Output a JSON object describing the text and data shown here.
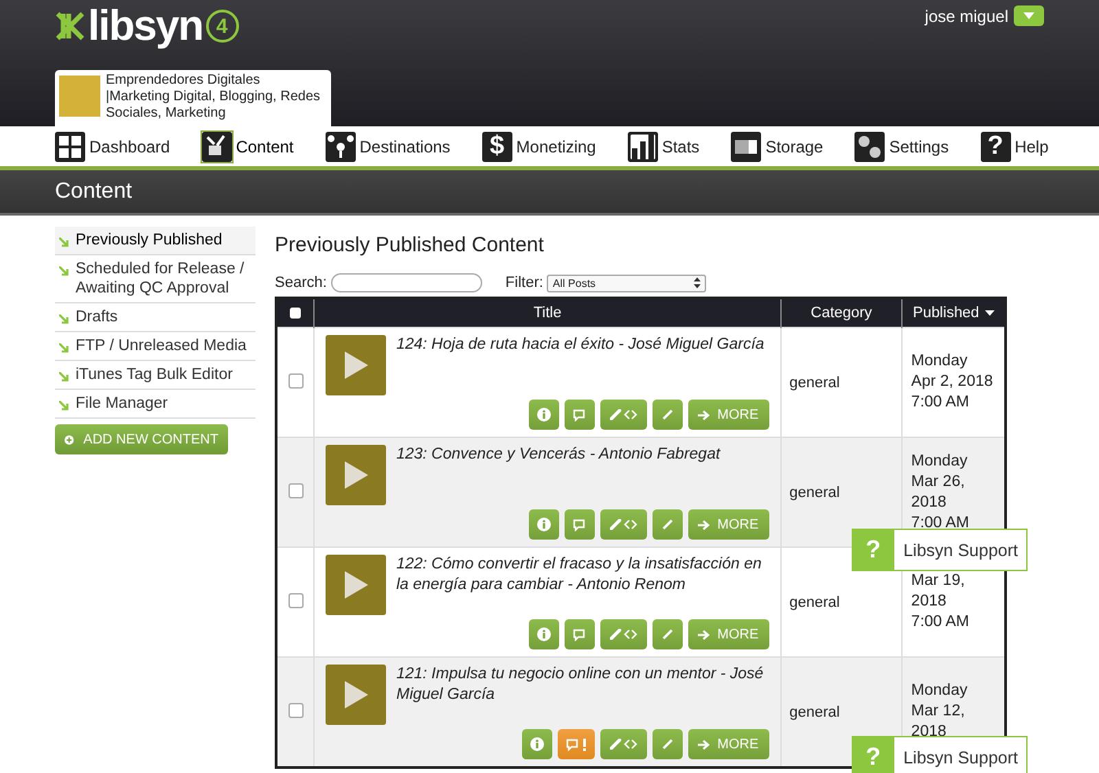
{
  "header": {
    "logo": "libsyn",
    "logo_badge": "4",
    "user": "jose miguel"
  },
  "podcast": {
    "title": "Emprendedores Digitales |Marketing Digital, Blogging, Redes Sociales, Marketing"
  },
  "nav": [
    {
      "label": "Dashboard",
      "selected": false
    },
    {
      "label": "Content",
      "selected": true
    },
    {
      "label": "Destinations",
      "selected": false
    },
    {
      "label": "Monetizing",
      "glyph": "$",
      "selected": false
    },
    {
      "label": "Stats",
      "selected": false
    },
    {
      "label": "Storage",
      "selected": false
    },
    {
      "label": "Settings",
      "selected": false
    },
    {
      "label": "Help",
      "glyph": "?",
      "selected": false
    }
  ],
  "page_title": "Content",
  "sidebar": {
    "items": [
      {
        "label": "Previously Published",
        "selected": true
      },
      {
        "label": "Scheduled for Release / Awaiting QC Approval",
        "selected": false
      },
      {
        "label": "Drafts",
        "selected": false
      },
      {
        "label": "FTP / Unreleased Media",
        "selected": false
      },
      {
        "label": "iTunes Tag Bulk Editor",
        "selected": false
      },
      {
        "label": "File Manager",
        "selected": false
      }
    ],
    "add_button": "ADD NEW CONTENT"
  },
  "main": {
    "title": "Previously Published Content",
    "search_label": "Search:",
    "filter_label": "Filter:",
    "filter_value": "All Posts"
  },
  "table": {
    "select_all_checked": false,
    "columns": [
      "Title",
      "Category",
      "Published"
    ],
    "rows": [
      {
        "title": "124: Hoja de ruta hacia el éxito - José Miguel García",
        "category": "general",
        "published": [
          "Monday",
          "Apr 2, 2018",
          "7:00 AM"
        ],
        "checked": false,
        "comment_alert": false,
        "more": "MORE"
      },
      {
        "title": "123: Convence y Vencerás - Antonio Fabregat",
        "category": "general",
        "published": [
          "Monday",
          "Mar 26, 2018",
          "7:00 AM"
        ],
        "checked": false,
        "comment_alert": false,
        "more": "MORE"
      },
      {
        "title": "122: Cómo convertir el fracaso y la insatisfacción en la energía para cambiar - Antonio Renom",
        "category": "general",
        "published": [
          "Mar 19, 2018",
          "7:00 AM"
        ],
        "checked": false,
        "comment_alert": false,
        "more": "MORE"
      },
      {
        "title": "121: Impulsa tu negocio online con un mentor - José Miguel García",
        "category": "general",
        "published": [
          "Monday",
          "Mar 12, 2018"
        ],
        "checked": false,
        "comment_alert": true,
        "more": "MORE"
      }
    ]
  },
  "support_widgets": [
    {
      "glyph": "?",
      "label": "Libsyn Support"
    },
    {
      "glyph": "?",
      "label": "Libsyn Support"
    }
  ]
}
